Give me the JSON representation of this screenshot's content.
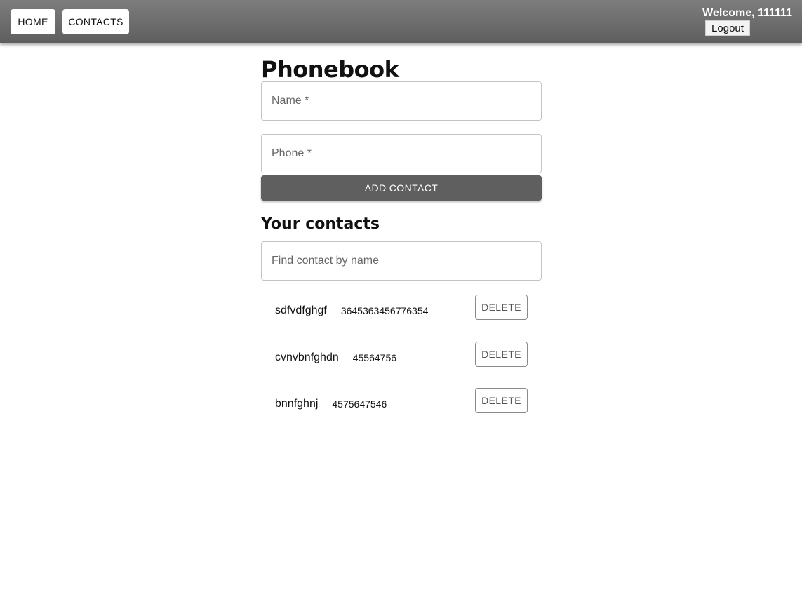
{
  "nav": {
    "home_label": "HOME",
    "contacts_label": "CONTACTS"
  },
  "user": {
    "welcome_text": "Welcome, 111111",
    "logout_label": "Logout"
  },
  "form": {
    "title": "Phonebook",
    "name_placeholder": "Name *",
    "phone_placeholder": "Phone *",
    "submit_label": "ADD CONTACT"
  },
  "contacts_section": {
    "title": "Your contacts",
    "search_placeholder": "Find contact by name",
    "delete_label": "DELETE",
    "items": [
      {
        "name": "sdfvdfghgf",
        "phone": "3645363456776354"
      },
      {
        "name": "cvnvbnfghdn",
        "phone": "45564756"
      },
      {
        "name": "bnnfghnj",
        "phone": "4575647546"
      }
    ]
  }
}
